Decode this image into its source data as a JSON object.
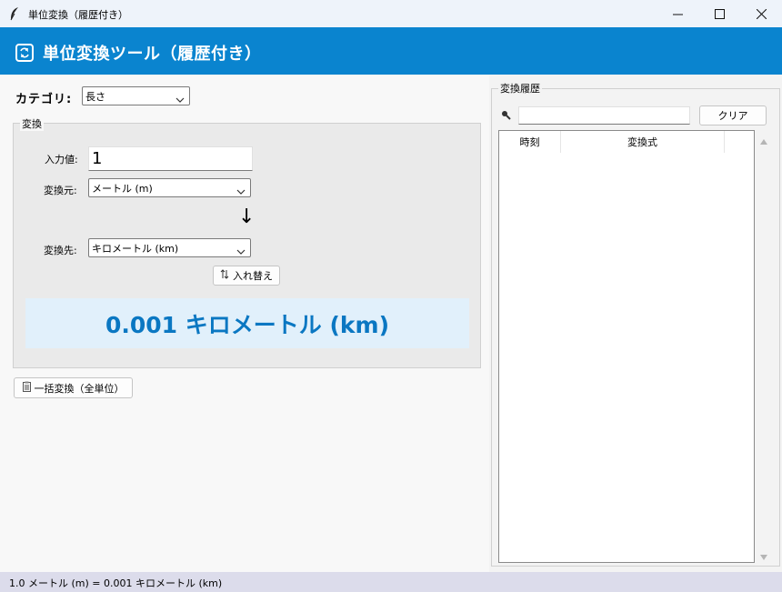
{
  "window": {
    "title": "単位変換（履歴付き）",
    "icon": "feather-icon",
    "controls": [
      "minimize-icon",
      "maximize-icon",
      "close-icon"
    ]
  },
  "header": {
    "icon": "swap-icon",
    "title": "単位変換ツール（履歴付き）",
    "background": "#0a84cf"
  },
  "category": {
    "label": "カテゴリ:",
    "value": "長さ"
  },
  "convert": {
    "group_title": "変換",
    "input_label": "入力値:",
    "input_value": "1",
    "from_label": "変換元:",
    "from_value": "メートル (m)",
    "to_label": "変換先:",
    "to_value": "キロメートル (km)",
    "arrow": "↓",
    "swap_label": "入れ替え",
    "result": "0.001 キロメートル (km)",
    "result_color": "#0a77c2"
  },
  "batch": {
    "label": "一括変換（全単位）"
  },
  "history": {
    "title": "変換履歴",
    "search_value": "",
    "clear_label": "クリア",
    "columns": [
      "時刻",
      "変換式"
    ],
    "rows": []
  },
  "status": {
    "text": "1.0 メートル (m) = 0.001 キロメートル (km)"
  }
}
